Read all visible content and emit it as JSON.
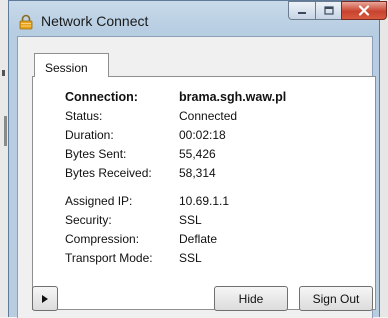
{
  "window": {
    "title": "Network Connect",
    "caption_buttons": [
      "minimize",
      "maximize",
      "close"
    ],
    "icon": "padlock-icon"
  },
  "tabs": [
    {
      "label": "Session",
      "selected": true
    }
  ],
  "session": {
    "connection": {
      "label": "Connection:",
      "value": "brama.sgh.waw.pl"
    },
    "status": {
      "label": "Status:",
      "value": "Connected"
    },
    "duration": {
      "label": "Duration:",
      "value": "00:02:18"
    },
    "bytes_sent": {
      "label": "Bytes Sent:",
      "value": "55,426"
    },
    "bytes_received": {
      "label": "Bytes Received:",
      "value": "58,314"
    },
    "assigned_ip": {
      "label": "Assigned IP:",
      "value": "10.69.1.1"
    },
    "security": {
      "label": "Security:",
      "value": "SSL"
    },
    "compression": {
      "label": "Compression:",
      "value": "Deflate"
    },
    "transport_mode": {
      "label": "Transport Mode:",
      "value": "SSL"
    }
  },
  "buttons": {
    "expand_icon": "play-arrow-icon",
    "hide": "Hide",
    "sign_out": "Sign Out"
  },
  "colors": {
    "title_bar": "#bfd3e7",
    "close_button": "#c8432e",
    "padlock": "#e8a11a"
  }
}
